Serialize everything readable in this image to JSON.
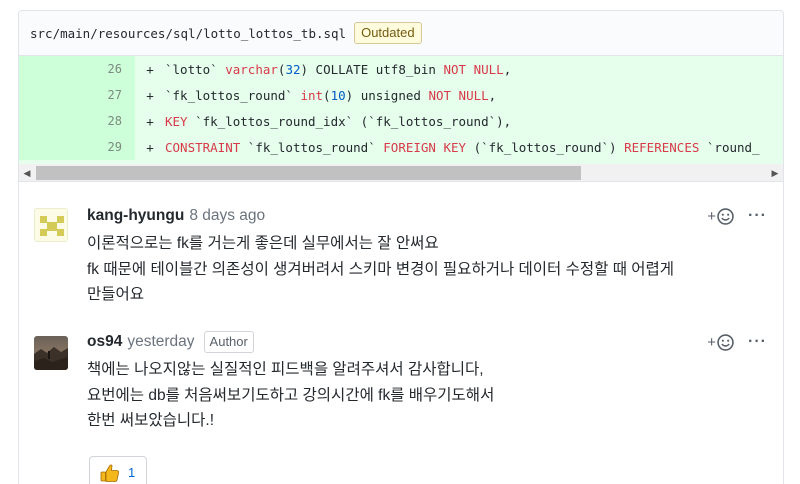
{
  "file": {
    "path": "src/main/resources/sql/lotto_lottos_tb.sql",
    "status": "Outdated"
  },
  "diff": {
    "lines": [
      {
        "num": "26",
        "marker": "+",
        "tokens": [
          {
            "t": "`lotto` ",
            "c": "code"
          },
          {
            "t": "varchar",
            "c": "kw"
          },
          {
            "t": "(",
            "c": "code"
          },
          {
            "t": "32",
            "c": "num"
          },
          {
            "t": ") COLLATE utf8_bin ",
            "c": "code"
          },
          {
            "t": "NOT NULL",
            "c": "kw"
          },
          {
            "t": ",",
            "c": "code"
          }
        ]
      },
      {
        "num": "27",
        "marker": "+",
        "tokens": [
          {
            "t": "`fk_lottos_round` ",
            "c": "code"
          },
          {
            "t": "int",
            "c": "kw"
          },
          {
            "t": "(",
            "c": "code"
          },
          {
            "t": "10",
            "c": "num"
          },
          {
            "t": ") unsigned ",
            "c": "code"
          },
          {
            "t": "NOT NULL",
            "c": "kw"
          },
          {
            "t": ",",
            "c": "code"
          }
        ]
      },
      {
        "num": "28",
        "marker": "+",
        "tokens": [
          {
            "t": "KEY",
            "c": "kw"
          },
          {
            "t": " `fk_lottos_round_idx` (`fk_lottos_round`),",
            "c": "code"
          }
        ]
      },
      {
        "num": "29",
        "marker": "+",
        "tokens": [
          {
            "t": "CONSTRAINT",
            "c": "kw"
          },
          {
            "t": " `fk_lottos_round` ",
            "c": "code"
          },
          {
            "t": "FOREIGN KEY",
            "c": "kw"
          },
          {
            "t": " (`fk_lottos_round`) ",
            "c": "code"
          },
          {
            "t": "REFERENCES",
            "c": "kw"
          },
          {
            "t": " `round_",
            "c": "code"
          }
        ]
      }
    ]
  },
  "icons": {
    "add_reaction": "smiley-icon",
    "more": "kebab-horizontal-icon",
    "reaction": "thumbs-up-icon"
  },
  "comments": [
    {
      "author": "kang-hyungu",
      "time": "8 days ago",
      "badge": "",
      "lines": [
        "이론적으로는 fk를 거는게 좋은데 실무에서는 잘 안써요",
        "fk 때문에 테이블간 의존성이 생겨버려서 스키마 변경이 필요하거나 데이터 수정할 때 어렵게",
        "만들어요"
      ]
    },
    {
      "author": "os94",
      "time": "yesterday",
      "badge": "Author",
      "lines": [
        "책에는 나오지않는 실질적인 피드백을 알려주셔서 감사합니다,",
        "요번에는 db를 처음써보기도하고 강의시간에 fk를 배우기도해서",
        "한번 써보았습니다.!"
      ],
      "reaction": {
        "emoji": "thumbs-up",
        "count": "1"
      }
    }
  ],
  "actions": {
    "add_reaction_plus": "+",
    "more": "···"
  },
  "colors": {
    "added_bg": "#e6ffed",
    "added_gutter": "#cdffd8",
    "keyword": "#d73a49",
    "number": "#005cc5",
    "link": "#0366d6",
    "outdated_bg": "#fffbdd"
  }
}
